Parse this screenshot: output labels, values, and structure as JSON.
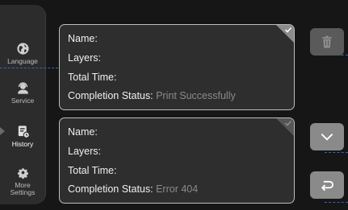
{
  "sidebar": {
    "items": [
      {
        "label": "Language",
        "icon": "globe-icon"
      },
      {
        "label": "Service",
        "icon": "support-agent-icon"
      },
      {
        "label": "History",
        "icon": "history-icon",
        "active": true
      },
      {
        "label": "More\nSettings",
        "icon": "gear-icon"
      }
    ]
  },
  "records": [
    {
      "name_label": "Name:",
      "layers_label": "Layers:",
      "time_label": "Total Time:",
      "status_label": "Completion Status:",
      "status_value": "Print Successfully",
      "selected": true
    },
    {
      "name_label": "Name:",
      "layers_label": "Layers:",
      "time_label": "Total Time:",
      "status_label": "Completion Status:",
      "status_value": "Error 404",
      "selected": false
    }
  ],
  "actions": {
    "delete_icon": "trash-icon",
    "down_icon": "chevron-down-icon",
    "back_icon": "return-icon"
  },
  "colors": {
    "background": "#161616",
    "card": "#2e2e2e",
    "card_border": "#bdbdbd",
    "button_disabled": "#5a5a5a",
    "button_active": "#8a8a8a",
    "guide_dash": "#3d63b5"
  }
}
